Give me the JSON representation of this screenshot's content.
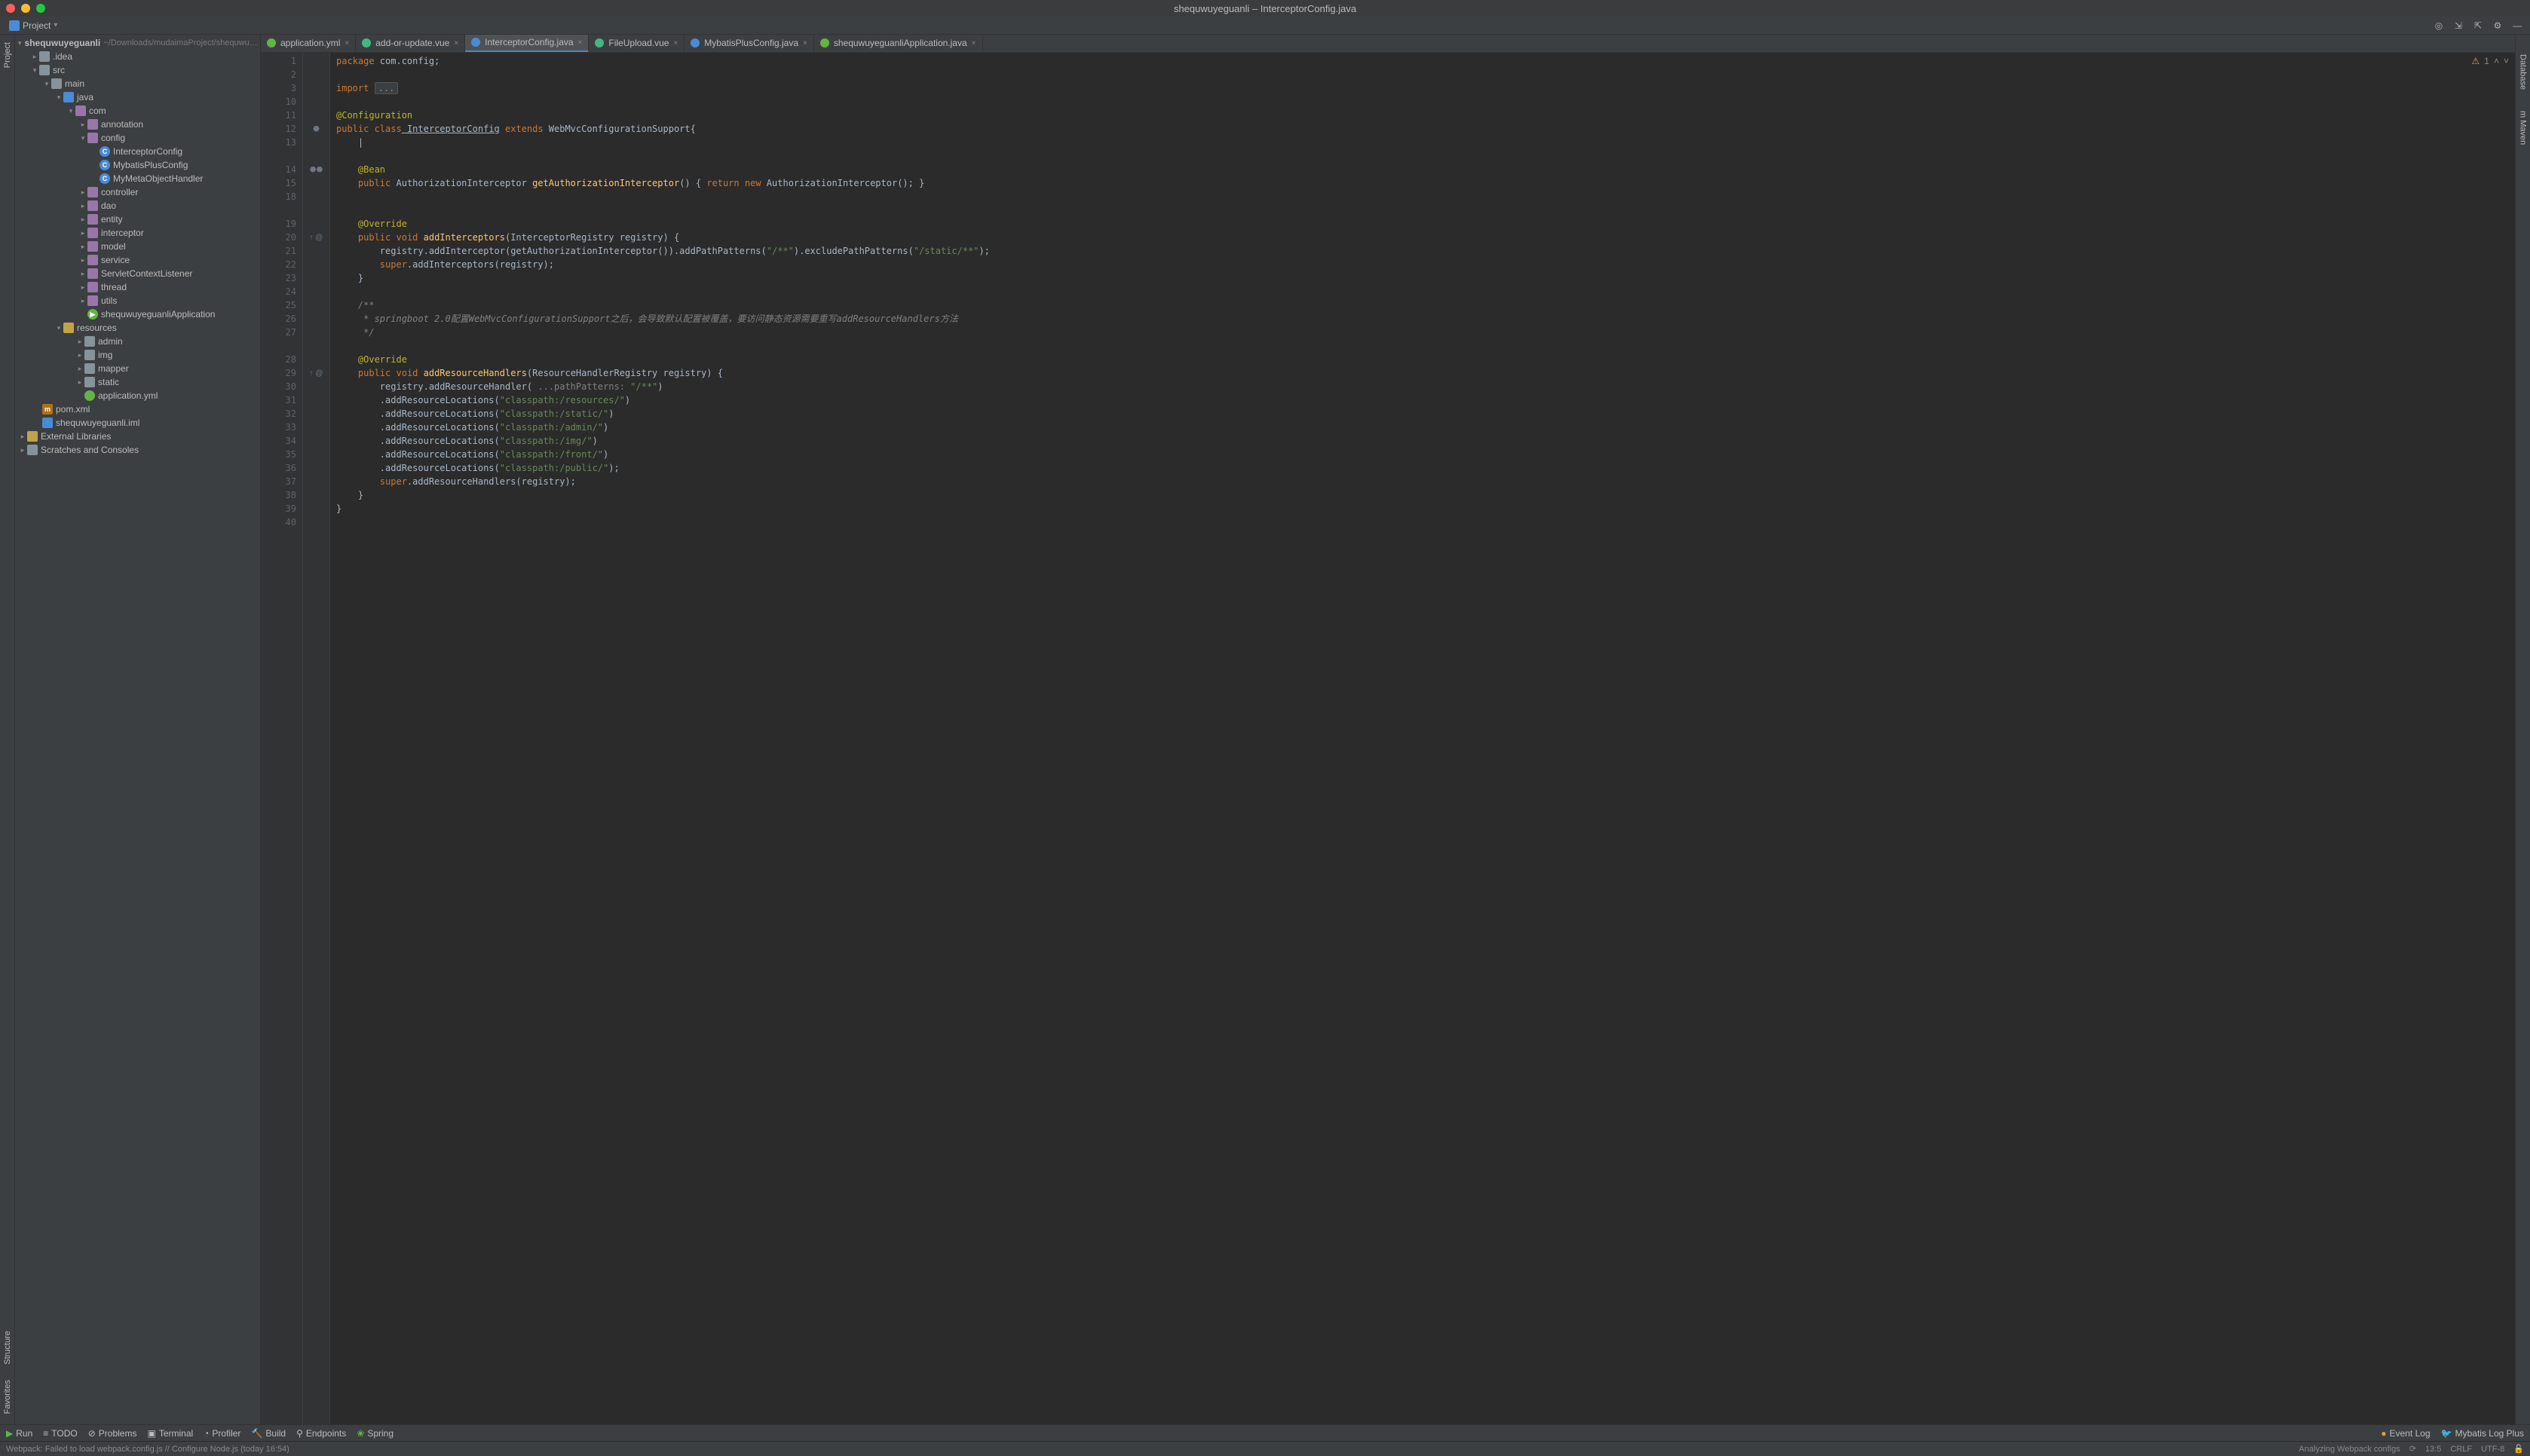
{
  "window": {
    "title": "shequwuyeguanli – InterceptorConfig.java"
  },
  "navbar": {
    "project_label": "Project"
  },
  "tree": {
    "root": {
      "name": "shequwuyeguanli",
      "path": "~/Downloads/mudaimaProject/shequwu…"
    },
    "idea": ".idea",
    "src": "src",
    "main": "main",
    "java": "java",
    "com": "com",
    "annotation": "annotation",
    "config": "config",
    "interceptorConfig": "InterceptorConfig",
    "mybatisPlusConfig": "MybatisPlusConfig",
    "myMetaObjectHandler": "MyMetaObjectHandler",
    "controller": "controller",
    "dao": "dao",
    "entity": "entity",
    "interceptor": "interceptor",
    "model": "model",
    "service": "service",
    "servletContextListener": "ServletContextListener",
    "thread": "thread",
    "utils": "utils",
    "appClass": "shequwuyeguanliApplication",
    "resources": "resources",
    "admin": "admin",
    "img": "img",
    "mapper": "mapper",
    "static": "static",
    "appyml": "application.yml",
    "pom": "pom.xml",
    "iml": "shequwuyeguanli.iml",
    "extlib": "External Libraries",
    "scratches": "Scratches and Consoles"
  },
  "tabs": [
    {
      "label": "application.yml",
      "icon": "#62b544"
    },
    {
      "label": "add-or-update.vue",
      "icon": "#41b883"
    },
    {
      "label": "InterceptorConfig.java",
      "icon": "#4a8bd6",
      "active": true
    },
    {
      "label": "FileUpload.vue",
      "icon": "#41b883"
    },
    {
      "label": "MybatisPlusConfig.java",
      "icon": "#4a8bd6"
    },
    {
      "label": "shequwuyeguanliApplication.java",
      "icon": "#62b544"
    }
  ],
  "editor": {
    "warning_count": "1",
    "gutter_lines": [
      "1",
      "2",
      "3",
      "10",
      "11",
      "12",
      "13",
      "",
      "14",
      "15",
      "18",
      "",
      "19",
      "20",
      "21",
      "22",
      "23",
      "24",
      "25",
      "26",
      "27",
      "",
      "28",
      "29",
      "30",
      "31",
      "32",
      "33",
      "34",
      "35",
      "36",
      "37",
      "38",
      "39",
      "40"
    ],
    "gutter_marks": [
      "",
      "",
      "",
      "",
      "",
      "⬣",
      "",
      "",
      "⬣⬣",
      "",
      "",
      "",
      "",
      "↑ @",
      "",
      "",
      "",
      "",
      "",
      "",
      "",
      "",
      "",
      "↑ @",
      "",
      "",
      "",
      "",
      "",
      "",
      "",
      "",
      "",
      "",
      ""
    ]
  },
  "code": {
    "l1_a": "package",
    "l1_b": " com.config;",
    "l3_a": "import",
    "l3_fold": "...",
    "l11": "@Configuration",
    "l12_a": "public",
    "l12_b": " class",
    "l12_c": " InterceptorConfig",
    "l12_d": " extends",
    "l12_e": " WebMvcConfigurationSupport{",
    "l14": "@Bean",
    "l15_a": "public",
    "l15_b": " AuthorizationInterceptor ",
    "l15_c": "getAuthorizationInterceptor",
    "l15_d": "() { ",
    "l15_e": "return",
    "l15_f": " new",
    "l15_g": " AuthorizationInterceptor(); }",
    "l19": "@Override",
    "l20_a": "public",
    "l20_b": " void",
    "l20_c": " addInterceptors",
    "l20_d": "(InterceptorRegistry registry) {",
    "l21_a": "        registry.addInterceptor(getAuthorizationInterceptor()).addPathPatterns(",
    "l21_b": "\"/**\"",
    "l21_c": ").excludePathPatterns(",
    "l21_d": "\"/static/**\"",
    "l21_e": ");",
    "l22_a": "        super",
    "l22_b": ".addInterceptors(registry);",
    "l23": "    }",
    "l25": "    /**",
    "l26": "     * springboot 2.0配置WebMvcConfigurationSupport之后，会导致默认配置被覆盖，要访问静态资源需要重写addResourceHandlers方法",
    "l27": "     */",
    "l28": "@Override",
    "l29_a": "public",
    "l29_b": " void",
    "l29_c": " addResourceHandlers",
    "l29_d": "(ResourceHandlerRegistry registry) {",
    "l30_a": "        registry.addResourceHandler(",
    "l30_hint": " ...pathPatterns: ",
    "l30_b": "\"/**\"",
    "l30_c": ")",
    "l31_a": "        .addResourceLocations(",
    "l31_b": "\"classpath:/resources/\"",
    "l31_c": ")",
    "l32_a": "        .addResourceLocations(",
    "l32_b": "\"classpath:/static/\"",
    "l32_c": ")",
    "l33_a": "        .addResourceLocations(",
    "l33_b": "\"classpath:/admin/\"",
    "l33_c": ")",
    "l34_a": "        .addResourceLocations(",
    "l34_b": "\"classpath:/img/\"",
    "l34_c": ")",
    "l35_a": "        .addResourceLocations(",
    "l35_b": "\"classpath:/front/\"",
    "l35_c": ")",
    "l36_a": "        .addResourceLocations(",
    "l36_b": "\"classpath:/public/\"",
    "l36_c": ");",
    "l37_a": "        super",
    "l37_b": ".addResourceHandlers(registry);",
    "l38": "    }",
    "l39": "}"
  },
  "bottom": {
    "run": "Run",
    "todo": "TODO",
    "problems": "Problems",
    "terminal": "Terminal",
    "profiler": "Profiler",
    "build": "Build",
    "endpoints": "Endpoints",
    "spring": "Spring",
    "eventlog": "Event Log",
    "mybatislog": "Mybatis Log Plus"
  },
  "status": {
    "message": "Webpack: Failed to load webpack.config.js // Configure Node.js (today 16:54)",
    "analyzing": "Analyzing Webpack configs",
    "pos": "13:5",
    "crlf": "CRLF",
    "enc": "UTF-8"
  }
}
